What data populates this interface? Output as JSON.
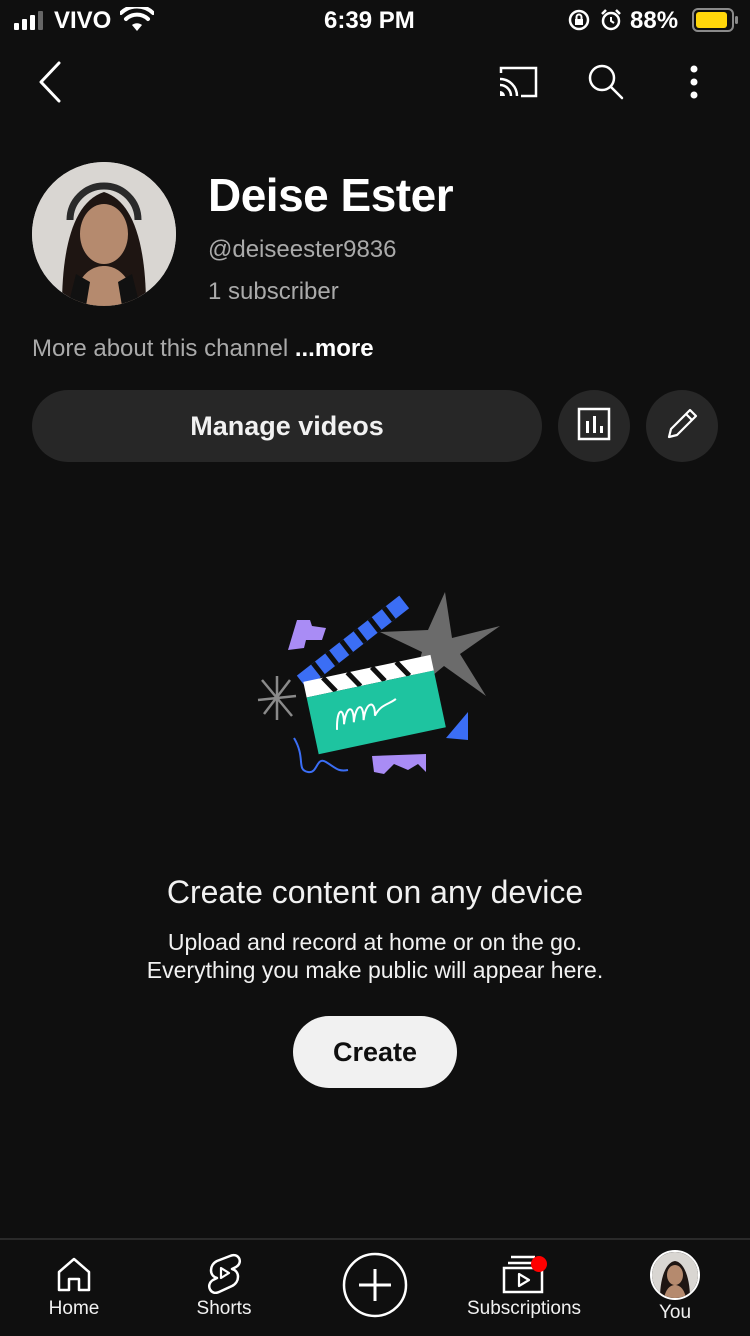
{
  "status_bar": {
    "carrier": "VIVO",
    "time": "6:39 PM",
    "battery": "88%",
    "battery_color": "#ffd60a"
  },
  "top_bar": {
    "icons": [
      "back-icon",
      "cast-icon",
      "search-icon",
      "more-vert-icon"
    ]
  },
  "profile": {
    "name": "Deise Ester",
    "handle": "@deiseester9836",
    "subscribers": "1 subscriber",
    "about_text": "More about this channel",
    "about_more": "...more"
  },
  "actions": {
    "manage_label": "Manage videos",
    "analytics_icon": "analytics-icon",
    "edit_icon": "pencil-icon"
  },
  "empty_state": {
    "title": "Create content on any device",
    "line1": "Upload and record at home or on the go.",
    "line2": "Everything you make public will appear here.",
    "create_label": "Create",
    "illustration": "clapperboard-illustration",
    "colors": {
      "teal": "#1ec4a0",
      "blue": "#3b6ef5",
      "purple": "#a98cf5",
      "gray": "#6b6b6b"
    }
  },
  "bottom_nav": {
    "items": [
      {
        "label": "Home",
        "icon": "home-icon"
      },
      {
        "label": "Shorts",
        "icon": "shorts-icon"
      },
      {
        "label": "",
        "icon": "create-plus-icon"
      },
      {
        "label": "Subscriptions",
        "icon": "subscriptions-icon"
      },
      {
        "label": "You",
        "icon": "avatar"
      }
    ],
    "notification_dot_color": "#ff0000"
  }
}
